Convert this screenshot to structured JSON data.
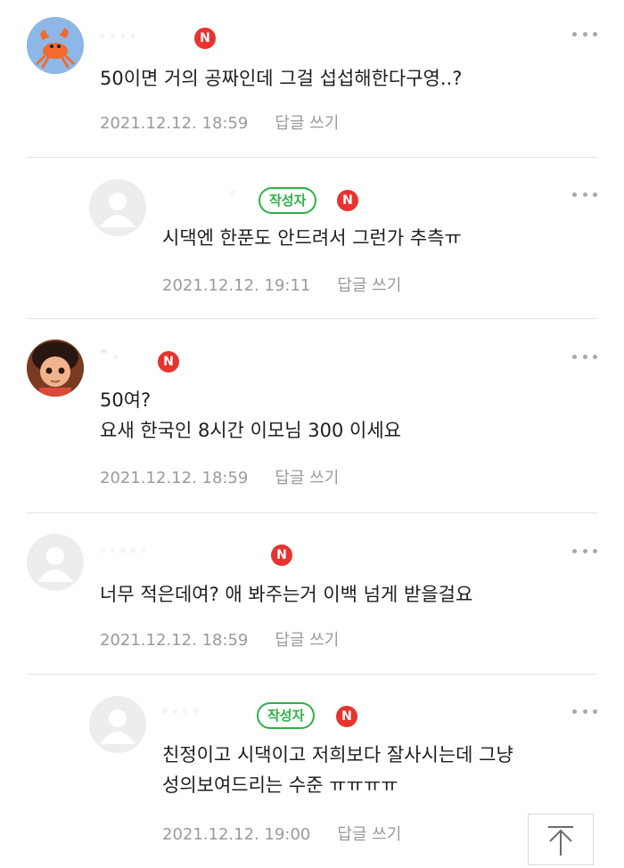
{
  "badges": {
    "author": "작성자",
    "new": "N"
  },
  "comments": [
    {
      "nickname": "· · · ·",
      "text_lines": [
        "50이면 거의 공짜인데 그걸 섭섭해한다구영..?"
      ],
      "date": "2021.12.12. 18:59",
      "reply": "답글 쓰기"
    },
    {
      "nickname": "·",
      "text_lines": [
        "시댁엔 한푼도 안드려서 그런가 추측ㅠ"
      ],
      "date": "2021.12.12. 19:11",
      "reply": "답글 쓰기"
    },
    {
      "nickname": "˜ ·",
      "text_lines": [
        "50여?",
        "요새 한국인 8시간 이모님 300 이세요"
      ],
      "date": "2021.12.12. 18:59",
      "reply": "답글 쓰기"
    },
    {
      "nickname": "· · · · ·",
      "text_lines": [
        "너무 적은데여? 애 봐주는거 이백 넘게 받을걸요"
      ],
      "date": "2021.12.12. 18:59",
      "reply": "답글 쓰기"
    },
    {
      "nickname": "· · · ·",
      "text_lines": [
        "친정이고 시댁이고 저희보다 잘사시는데 그냥",
        "성의보여드리는 수준 ㅠㅠㅠㅠ"
      ],
      "date": "2021.12.12. 19:00",
      "reply": "답글 쓰기"
    }
  ]
}
